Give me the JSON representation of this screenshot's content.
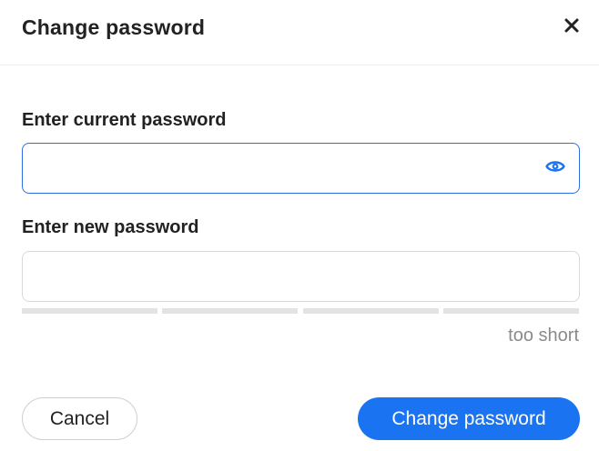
{
  "dialog": {
    "title": "Change password",
    "close_icon": "close-icon"
  },
  "current_password": {
    "label": "Enter current password",
    "value": "",
    "placeholder": "",
    "toggle_icon": "eye-icon",
    "focused": true
  },
  "new_password": {
    "label": "Enter new password",
    "value": "",
    "placeholder": "",
    "strength": {
      "text": "too short",
      "filled_segments": 0,
      "total_segments": 4
    }
  },
  "actions": {
    "cancel_label": "Cancel",
    "submit_label": "Change password"
  },
  "colors": {
    "accent": "#1a73f0",
    "focus_border": "#2f6fe0",
    "strength_empty": "#e3e3e3",
    "muted_text": "#8a8a8a"
  }
}
